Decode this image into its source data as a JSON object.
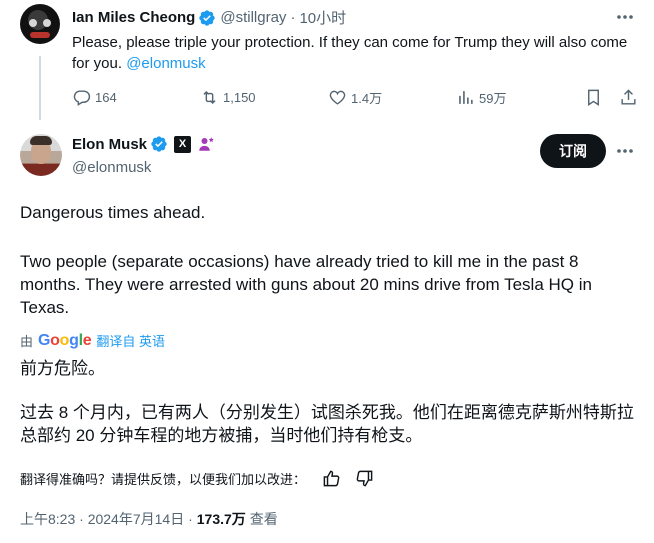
{
  "reply": {
    "name": "Ian Miles Cheong",
    "handle": "@stillgray",
    "separator": "·",
    "time": "10小时",
    "text": "Please, please triple your protection. If they can come for Trump they will also come for you. ",
    "mention": "@elonmusk",
    "stats": {
      "replies": "164",
      "reposts": "1,150",
      "likes": "1.4万",
      "views": "59万"
    }
  },
  "main": {
    "name": "Elon Musk",
    "handle": "@elonmusk",
    "subscribe_label": "订阅",
    "x_badge": "X",
    "paragraph1": "Dangerous times ahead.",
    "paragraph2": "Two people (separate occasions) have already tried to kill me in the past 8 months. They were arrested with guns about 20 mins drive from Tesla HQ in Texas.",
    "translated_by_prefix": "由",
    "google_letters": [
      "G",
      "o",
      "o",
      "g",
      "l",
      "e"
    ],
    "translated_from": "翻译自 英语",
    "zh_paragraph1": "前方危险。",
    "zh_paragraph2": "过去 8 个月内，已有两人（分别发生）试图杀死我。他们在距离德克萨斯州特斯拉总部约 20 分钟车程的地方被捕，当时他们持有枪支。",
    "feedback_prompt": "翻译得准确吗？请提供反馈，以便我们加以改进：",
    "timestamp": "上午8:23 · 2024年7月14日 · ",
    "views_count": "173.7万",
    "views_label": "查看"
  },
  "colors": {
    "accent": "#1d9bf0",
    "text": "#0f1419",
    "secondary": "#536471",
    "thread_line": "#cfd9de"
  }
}
